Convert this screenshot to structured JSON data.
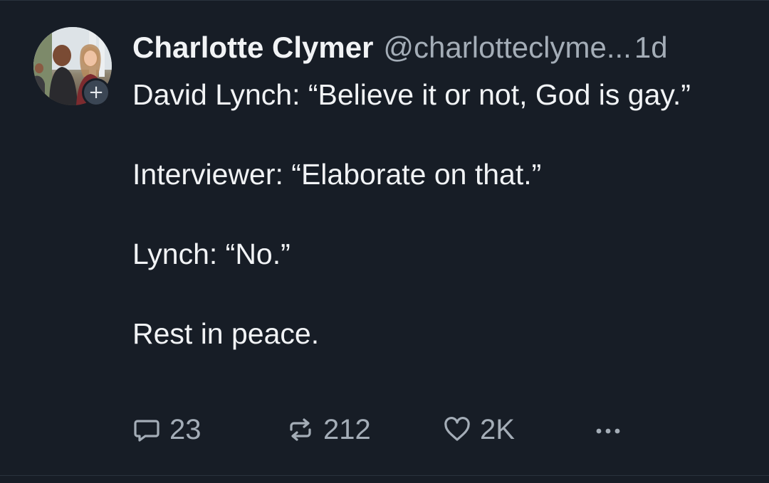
{
  "post": {
    "author": {
      "display_name": "Charlotte Clymer",
      "handle": "@charlotteclyme...",
      "avatar_icon": "profile-photo",
      "follow_badge": "+"
    },
    "time": "1d",
    "body": [
      "David Lynch: “Believe it or not, God is gay.”",
      "Interviewer: “Elaborate on that.”",
      "Lynch: “No.”",
      "Rest in peace."
    ],
    "actions": {
      "replies": "23",
      "reposts": "212",
      "likes": "2K"
    }
  },
  "colors": {
    "background": "#171d26",
    "text": "#f1f3f5",
    "muted": "#a4adb7"
  }
}
